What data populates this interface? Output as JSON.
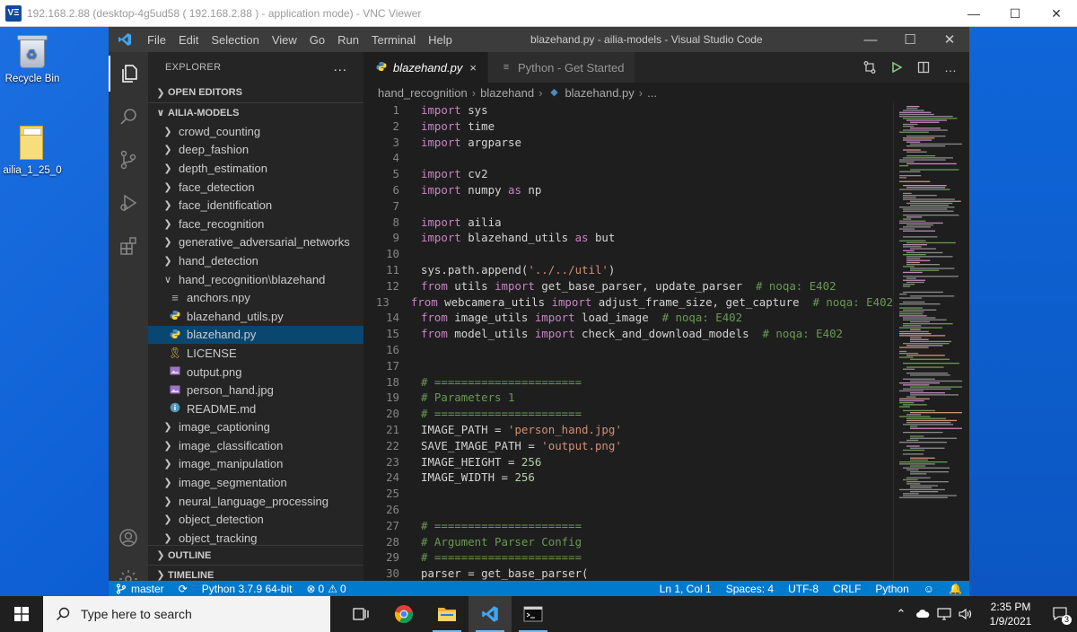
{
  "vnc": {
    "title": "192.168.2.88 (desktop-4g5ud58 ( 192.168.2.88 ) - application mode) - VNC Viewer",
    "logo_text": "VΞ"
  },
  "desktop": {
    "icons": [
      {
        "label": "Recycle Bin",
        "icon": "recycle-bin-icon"
      },
      {
        "label": "ailia_1_25_0",
        "icon": "folder-icon"
      }
    ]
  },
  "vscode": {
    "title": "blazehand.py - ailia-models - Visual Studio Code",
    "menu": [
      "File",
      "Edit",
      "Selection",
      "View",
      "Go",
      "Run",
      "Terminal",
      "Help"
    ],
    "explorer": {
      "header": "EXPLORER",
      "open_editors": "OPEN EDITORS",
      "project": "AILIA-MODELS",
      "tree": [
        {
          "label": "crowd_counting",
          "type": "folder"
        },
        {
          "label": "deep_fashion",
          "type": "folder"
        },
        {
          "label": "depth_estimation",
          "type": "folder"
        },
        {
          "label": "face_detection",
          "type": "folder"
        },
        {
          "label": "face_identification",
          "type": "folder"
        },
        {
          "label": "face_recognition",
          "type": "folder"
        },
        {
          "label": "generative_adversarial_networks",
          "type": "folder"
        },
        {
          "label": "hand_detection",
          "type": "folder"
        },
        {
          "label": "hand_recognition",
          "sub": "blazehand",
          "type": "folder-open"
        },
        {
          "label": "anchors.npy",
          "type": "file-generic"
        },
        {
          "label": "blazehand_utils.py",
          "type": "file-python"
        },
        {
          "label": "blazehand.py",
          "type": "file-python",
          "selected": true
        },
        {
          "label": "LICENSE",
          "type": "file-license"
        },
        {
          "label": "output.png",
          "type": "file-image"
        },
        {
          "label": "person_hand.jpg",
          "type": "file-image"
        },
        {
          "label": "README.md",
          "type": "file-info"
        },
        {
          "label": "image_captioning",
          "type": "folder"
        },
        {
          "label": "image_classification",
          "type": "folder"
        },
        {
          "label": "image_manipulation",
          "type": "folder"
        },
        {
          "label": "image_segmentation",
          "type": "folder"
        },
        {
          "label": "neural_language_processing",
          "type": "folder"
        },
        {
          "label": "object_detection",
          "type": "folder"
        },
        {
          "label": "object_tracking",
          "type": "folder"
        }
      ],
      "outline": "OUTLINE",
      "timeline": "TIMELINE"
    },
    "tabs": [
      {
        "label": "blazehand.py",
        "active": true,
        "close": "×"
      },
      {
        "label": "Python - Get Started",
        "active": false
      }
    ],
    "breadcrumb": [
      "hand_recognition",
      "blazehand",
      "blazehand.py",
      "..."
    ],
    "code": [
      {
        "n": "1",
        "t": [
          [
            "kw",
            "import"
          ],
          [
            "",
            " sys"
          ]
        ]
      },
      {
        "n": "2",
        "t": [
          [
            "kw",
            "import"
          ],
          [
            "",
            " time"
          ]
        ]
      },
      {
        "n": "3",
        "t": [
          [
            "kw",
            "import"
          ],
          [
            "",
            " argparse"
          ]
        ]
      },
      {
        "n": "4",
        "t": []
      },
      {
        "n": "5",
        "t": [
          [
            "kw",
            "import"
          ],
          [
            "",
            " cv2"
          ]
        ]
      },
      {
        "n": "6",
        "t": [
          [
            "kw",
            "import"
          ],
          [
            "",
            " numpy "
          ],
          [
            "kw",
            "as"
          ],
          [
            "",
            " np"
          ]
        ]
      },
      {
        "n": "7",
        "t": []
      },
      {
        "n": "8",
        "t": [
          [
            "kw",
            "import"
          ],
          [
            "",
            " ailia"
          ]
        ]
      },
      {
        "n": "9",
        "t": [
          [
            "kw",
            "import"
          ],
          [
            "",
            " blazehand_utils "
          ],
          [
            "kw",
            "as"
          ],
          [
            "",
            " but"
          ]
        ]
      },
      {
        "n": "10",
        "t": []
      },
      {
        "n": "11",
        "t": [
          [
            "",
            "sys.path.append("
          ],
          [
            "str",
            "'../../util'"
          ],
          [
            "",
            ")"
          ]
        ]
      },
      {
        "n": "12",
        "t": [
          [
            "kw",
            "from"
          ],
          [
            "",
            " utils "
          ],
          [
            "kw",
            "import"
          ],
          [
            "",
            " get_base_parser, update_parser  "
          ],
          [
            "com",
            "# noqa: E402"
          ]
        ]
      },
      {
        "n": "13",
        "t": [
          [
            "kw",
            "from"
          ],
          [
            "",
            " webcamera_utils "
          ],
          [
            "kw",
            "import"
          ],
          [
            "",
            " adjust_frame_size, get_capture  "
          ],
          [
            "com",
            "# noqa: E402"
          ]
        ]
      },
      {
        "n": "14",
        "t": [
          [
            "kw",
            "from"
          ],
          [
            "",
            " image_utils "
          ],
          [
            "kw",
            "import"
          ],
          [
            "",
            " load_image  "
          ],
          [
            "com",
            "# noqa: E402"
          ]
        ]
      },
      {
        "n": "15",
        "t": [
          [
            "kw",
            "from"
          ],
          [
            "",
            " model_utils "
          ],
          [
            "kw",
            "import"
          ],
          [
            "",
            " check_and_download_models  "
          ],
          [
            "com",
            "# noqa: E402"
          ]
        ]
      },
      {
        "n": "16",
        "t": []
      },
      {
        "n": "17",
        "t": []
      },
      {
        "n": "18",
        "t": [
          [
            "com",
            "# ======================"
          ]
        ]
      },
      {
        "n": "19",
        "t": [
          [
            "com",
            "# Parameters 1"
          ]
        ]
      },
      {
        "n": "20",
        "t": [
          [
            "com",
            "# ======================"
          ]
        ]
      },
      {
        "n": "21",
        "t": [
          [
            "",
            "IMAGE_PATH = "
          ],
          [
            "str",
            "'person_hand.jpg'"
          ]
        ]
      },
      {
        "n": "22",
        "t": [
          [
            "",
            "SAVE_IMAGE_PATH = "
          ],
          [
            "str",
            "'output.png'"
          ]
        ]
      },
      {
        "n": "23",
        "t": [
          [
            "",
            "IMAGE_HEIGHT = "
          ],
          [
            "num",
            "256"
          ]
        ]
      },
      {
        "n": "24",
        "t": [
          [
            "",
            "IMAGE_WIDTH = "
          ],
          [
            "num",
            "256"
          ]
        ]
      },
      {
        "n": "25",
        "t": []
      },
      {
        "n": "26",
        "t": []
      },
      {
        "n": "27",
        "t": [
          [
            "com",
            "# ======================"
          ]
        ]
      },
      {
        "n": "28",
        "t": [
          [
            "com",
            "# Argument Parser Config"
          ]
        ]
      },
      {
        "n": "29",
        "t": [
          [
            "com",
            "# ======================"
          ]
        ]
      },
      {
        "n": "30",
        "t": [
          [
            "",
            "parser = get_base_parser("
          ]
        ]
      }
    ],
    "status": {
      "branch": "master",
      "python": "Python 3.7.9 64-bit",
      "errors": "0",
      "warnings": "0",
      "position": "Ln 1, Col 1",
      "spaces": "Spaces: 4",
      "encoding": "UTF-8",
      "eol": "CRLF",
      "language": "Python"
    }
  },
  "taskbar": {
    "search_placeholder": "Type here to search",
    "time": "2:35 PM",
    "date": "1/9/2021",
    "notifications": "3"
  },
  "colors": {
    "accent": "#007acc",
    "keyword": "#c586c0",
    "string": "#ce9178",
    "comment": "#6a9955",
    "number": "#b5cea8",
    "selection": "#094771"
  }
}
